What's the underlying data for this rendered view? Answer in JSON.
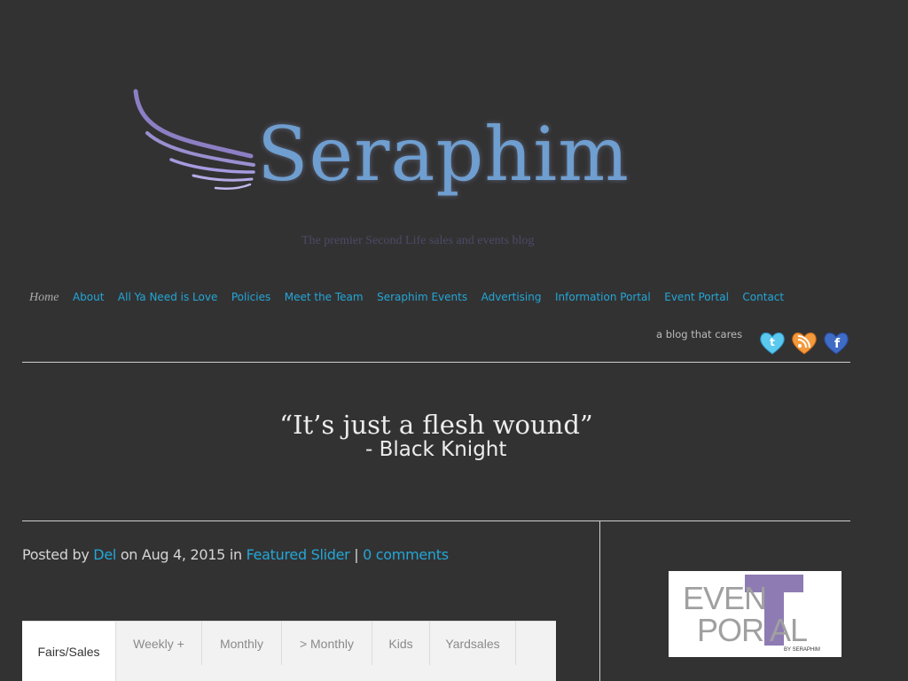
{
  "site": {
    "name": "Seraphim",
    "tagline": "The premier Second Life sales and events blog"
  },
  "nav": {
    "items": [
      {
        "label": "Home"
      },
      {
        "label": "About"
      },
      {
        "label": "All Ya Need is Love"
      },
      {
        "label": "Policies"
      },
      {
        "label": "Meet the Team"
      },
      {
        "label": "Seraphim Events"
      },
      {
        "label": "Advertising"
      },
      {
        "label": "Information Portal"
      },
      {
        "label": "Event Portal"
      },
      {
        "label": "Contact"
      }
    ]
  },
  "header": {
    "blog_tag": "a blog that cares",
    "social": [
      "twitter-icon",
      "rss-icon",
      "facebook-icon"
    ]
  },
  "quote": {
    "text": "“It’s just a flesh wound”",
    "by": "- Black Knight"
  },
  "post": {
    "posted_by": "Posted by",
    "author": "Del",
    "on_date": "on Aug 4, 2015 in",
    "category": "Featured Slider",
    "separator": "|",
    "comments": "0 comments"
  },
  "tabs": [
    {
      "label": "Fairs/Sales",
      "active": true
    },
    {
      "label": "Weekly +"
    },
    {
      "label": "Monthly"
    },
    {
      "label": "> Monthly"
    },
    {
      "label": "Kids"
    },
    {
      "label": "Yardsales"
    }
  ],
  "sidebar": {
    "ep_line1": "EVEN",
    "ep_line2": "POR AL",
    "ep_by": "BY SERAPHIM"
  },
  "colors": {
    "background": "#333233",
    "link": "#22a7d6",
    "accent": "#8e7bb3"
  }
}
